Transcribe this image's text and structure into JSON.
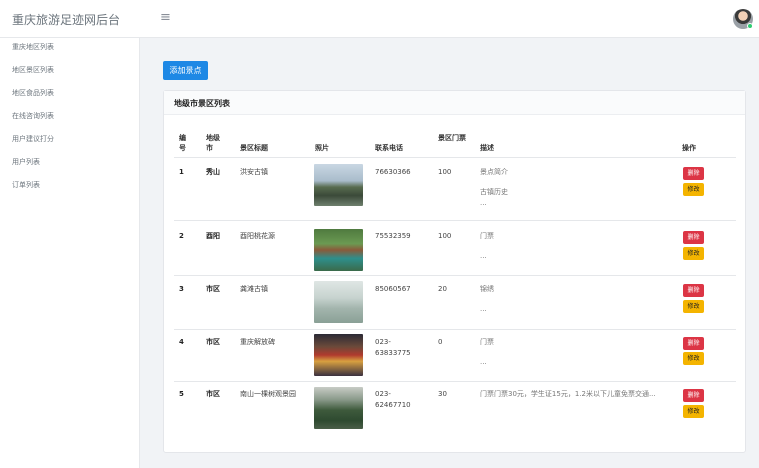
{
  "app": {
    "title": "重庆旅游足迹网后台",
    "menu_icon": "hamburger-icon"
  },
  "sidebar": {
    "items": [
      {
        "label": "重庆地区列表"
      },
      {
        "label": "地区景区列表"
      },
      {
        "label": "地区食品列表"
      },
      {
        "label": "在线咨询列表"
      },
      {
        "label": "用户建议打分"
      },
      {
        "label": "用户列表"
      },
      {
        "label": "订单列表"
      }
    ]
  },
  "toolbar": {
    "add_label": "添加景点"
  },
  "card": {
    "title": "地级市景区列表"
  },
  "table": {
    "headers": {
      "id": "编号",
      "city": "地级市",
      "name": "景区标题",
      "photo": "照片",
      "phone": "联系电话",
      "ticket": "景区门票",
      "desc": "描述",
      "ops": "操作"
    },
    "delete_label": "删除",
    "edit_label": "修改",
    "rows": [
      {
        "id": "1",
        "city": "秀山",
        "name": "洪安古镇",
        "phone": "76630366",
        "ticket": "100",
        "desc1": "景点简介",
        "desc2": "古镇历史",
        "desc3": "..."
      },
      {
        "id": "2",
        "city": "酉阳",
        "name": "酉阳桃花源",
        "phone": "75532359",
        "ticket": "100",
        "desc1": "门票",
        "desc2": "...",
        "desc3": ""
      },
      {
        "id": "3",
        "city": "市区",
        "name": "龚滩古镇",
        "phone": "85060567",
        "ticket": "20",
        "desc1": "锦绣",
        "desc2": "...",
        "desc3": ""
      },
      {
        "id": "4",
        "city": "市区",
        "name": "重庆解放碑",
        "phone": "023-63833775",
        "ticket": "0",
        "desc1": "门票",
        "desc2": "...",
        "desc3": ""
      },
      {
        "id": "5",
        "city": "市区",
        "name": "南山一棵树观景园",
        "phone": "023-62467710",
        "ticket": "30",
        "desc1": "门票门票30元，学生证15元，1.2米以下儿童免票交通...",
        "desc2": "",
        "desc3": ""
      }
    ]
  },
  "colors": {
    "primary": "#1e88e5",
    "danger": "#dc3545",
    "warning": "#f4b400"
  }
}
